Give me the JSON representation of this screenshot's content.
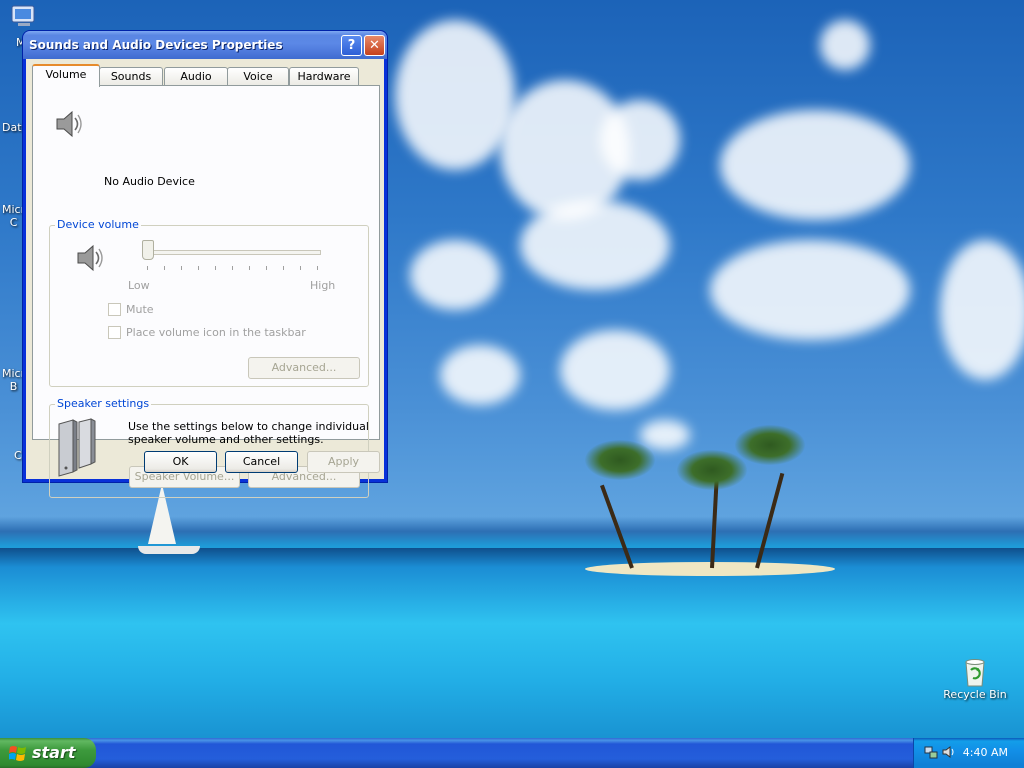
{
  "desktop": {
    "icons": [
      {
        "label": "My",
        "icon": "computer-icon"
      },
      {
        "label": "Dat",
        "icon": "folder-icon"
      },
      {
        "label": "Micr",
        "icon": "app-icon"
      },
      {
        "label": "C",
        "icon": "app-icon"
      },
      {
        "label": "Micr",
        "icon": "app-icon"
      },
      {
        "label": "B",
        "icon": "app-icon"
      },
      {
        "label": "C",
        "icon": "app-icon"
      }
    ],
    "recycle_bin": "Recycle Bin"
  },
  "window": {
    "title": "Sounds and Audio Devices Properties",
    "help_label": "?",
    "close_label": "✕",
    "tabs": [
      {
        "label": "Volume",
        "active": true
      },
      {
        "label": "Sounds",
        "active": false
      },
      {
        "label": "Audio",
        "active": false
      },
      {
        "label": "Voice",
        "active": false
      },
      {
        "label": "Hardware",
        "active": false
      }
    ],
    "device_name": "No Audio Device",
    "device_volume": {
      "group_label": "Device volume",
      "low": "Low",
      "high": "High",
      "level": 0,
      "mute": "Mute",
      "place_icon": "Place volume icon in the taskbar",
      "advanced": "Advanced..."
    },
    "speaker_settings": {
      "group_label": "Speaker settings",
      "description_line1": "Use the settings below to change individual",
      "description_line2": "speaker volume and other settings.",
      "speaker_volume": "Speaker Volume...",
      "advanced": "Advanced..."
    },
    "buttons": {
      "ok": "OK",
      "cancel": "Cancel",
      "apply": "Apply"
    }
  },
  "taskbar": {
    "start": "start",
    "clock": "4:40 AM"
  },
  "colors": {
    "accent": "#0046d5",
    "titlebar": "#0831d9",
    "start": "#3d9a3d"
  }
}
